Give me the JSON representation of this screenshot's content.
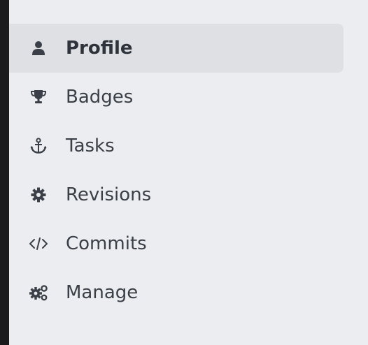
{
  "colors": {
    "background": "#ecedf0",
    "active_background": "#dfe0e4",
    "text": "#3b4048",
    "left_edge": "#1b1b1d"
  },
  "sidebar": {
    "active_item": "Profile",
    "items": [
      {
        "label": "Profile",
        "icon": "user-icon"
      },
      {
        "label": "Badges",
        "icon": "trophy-icon"
      },
      {
        "label": "Tasks",
        "icon": "anchor-icon"
      },
      {
        "label": "Revisions",
        "icon": "gear-icon"
      },
      {
        "label": "Commits",
        "icon": "code-icon"
      },
      {
        "label": "Manage",
        "icon": "gears-icon"
      }
    ]
  }
}
